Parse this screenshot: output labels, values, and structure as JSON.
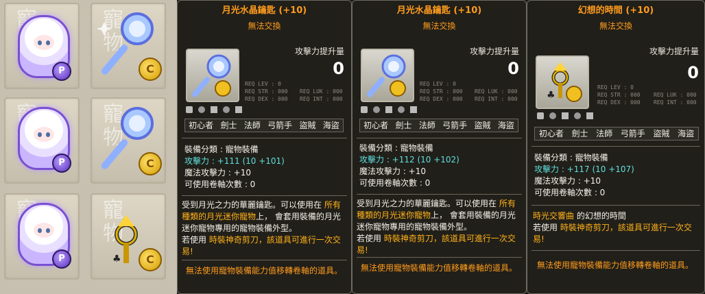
{
  "inventory": {
    "ghost_text": "寵物",
    "coin_p": "P",
    "coin_c": "C"
  },
  "tooltips": [
    {
      "title": "月光水晶鑰匙 (+10)",
      "tradeable": "無法交換",
      "attack_label": "攻擊力提升量",
      "attack_value": "0",
      "req_left": [
        "REQ LEV : 0",
        "REQ STR : 000",
        "REQ DEX : 000"
      ],
      "req_right": [
        "REQ LUK : 000",
        "REQ INT : 000"
      ],
      "jobs": [
        "初心者",
        "劍士",
        "法師",
        "弓箭手",
        "盜賊",
        "海盜"
      ],
      "category": "裝備分類 : 寵物裝備",
      "attack_line": "攻擊力 : +111 (10 +101)",
      "magic_line": "魔法攻擊力 : +10",
      "scroll_line": "可使用卷軸次數 : 0",
      "desc_plain1": "受到月光之力的華麗鑰匙。可以使用在",
      "desc_highlight": "所有種類的月光迷你寵物",
      "desc_plain2": "上， 會套用裝備的月光迷你寵物專用的寵物裝備外型。",
      "scissor_prefix": "若使用",
      "scissor_highlight": "時裝神奇剪刀，該道具可進行一次交易!",
      "footer": "無法使用寵物裝備能力值移轉卷軸的道具。"
    },
    {
      "title": "月光水晶鑰匙 (+10)",
      "tradeable": "無法交換",
      "attack_label": "攻擊力提升量",
      "attack_value": "0",
      "req_left": [
        "REQ LEV : 0",
        "REQ STR : 000",
        "REQ DEX : 000"
      ],
      "req_right": [
        "REQ LUK : 000",
        "REQ INT : 000"
      ],
      "jobs": [
        "初心者",
        "劍士",
        "法師",
        "弓箭手",
        "盜賊",
        "海盜"
      ],
      "category": "裝備分類 : 寵物裝備",
      "attack_line": "攻擊力 : +112 (10 +102)",
      "magic_line": "魔法攻擊力 : +10",
      "scroll_line": "可使用卷軸次數 : 0",
      "desc_plain1": "受到月光之力的華麗鑰匙。可以使用在",
      "desc_highlight": "所有種類的月光迷你寵物",
      "desc_plain2": "上， 會套用裝備的月光迷你寵物專用的寵物裝備外型。",
      "scissor_prefix": "若使用",
      "scissor_highlight": "時裝神奇剪刀，該道具可進行一次交易!",
      "footer": "無法使用寵物裝備能力值移轉卷軸的道具。"
    },
    {
      "title": "幻想的時間 (+10)",
      "tradeable": "無法交換",
      "attack_label": "攻擊力提升量",
      "attack_value": "0",
      "req_left": [
        "REQ LEV : 0",
        "REQ STR : 000",
        "REQ DEX : 000"
      ],
      "req_right": [
        "REQ LUK : 000",
        "REQ INT : 000"
      ],
      "jobs": [
        "初心者",
        "劍士",
        "法師",
        "弓箭手",
        "盜賊",
        "海盜"
      ],
      "category": "裝備分類 : 寵物裝備",
      "attack_line": "攻擊力 : +117 (10 +107)",
      "magic_line": "魔法攻擊力 : +10",
      "scroll_line": "可使用卷軸次數 : 0",
      "set_line_highlight": "時光交響曲",
      "set_line_plain": "的幻想的時間",
      "scissor_prefix": "若使用",
      "scissor_highlight": "時裝神奇剪刀，該道具可進行一次交易!",
      "footer": "無法使用寵物裝備能力值移轉卷軸的道具。"
    }
  ]
}
